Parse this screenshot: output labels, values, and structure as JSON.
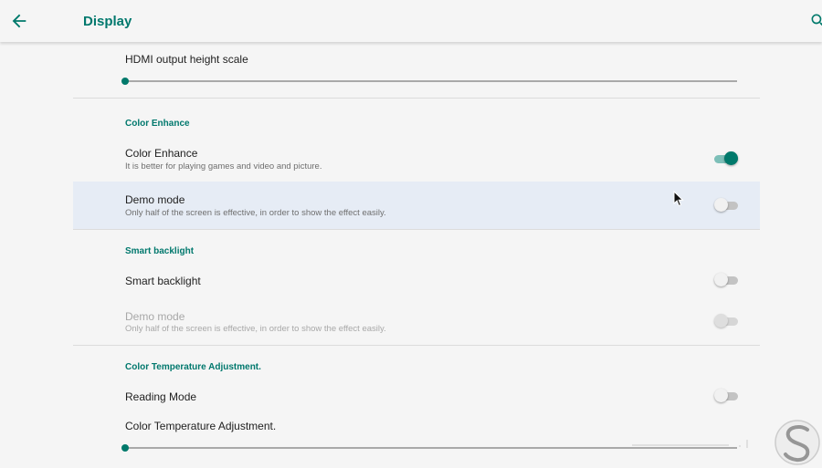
{
  "appbar": {
    "title": "Display",
    "back_icon": "arrow-back-icon",
    "search_icon": "search-icon"
  },
  "hdmi_height": {
    "title": "HDMI output height scale",
    "value": 0
  },
  "color_enhance_section": {
    "header": "Color Enhance",
    "color_enhance": {
      "title": "Color Enhance",
      "summary": "It is better for playing games and video and picture.",
      "checked": true
    },
    "demo_mode": {
      "title": "Demo mode",
      "summary": "Only half of the screen is effective, in order to show the effect easily.",
      "checked": false
    }
  },
  "smart_backlight_section": {
    "header": "Smart backlight",
    "smart_backlight": {
      "title": "Smart backlight",
      "checked": false
    },
    "demo_mode": {
      "title": "Demo mode",
      "summary": "Only half of the screen is effective, in order to show the effect easily.",
      "checked": false,
      "enabled": false
    }
  },
  "color_temp_section": {
    "header": "Color Temperature Adjustment.",
    "reading_mode": {
      "title": "Reading Mode",
      "checked": false
    },
    "color_temp": {
      "title": "Color Temperature Adjustment.",
      "value": 0
    }
  },
  "colors": {
    "accent": "#00796b",
    "accent_text": "#00786d",
    "highlight": "#e6ecf5"
  }
}
